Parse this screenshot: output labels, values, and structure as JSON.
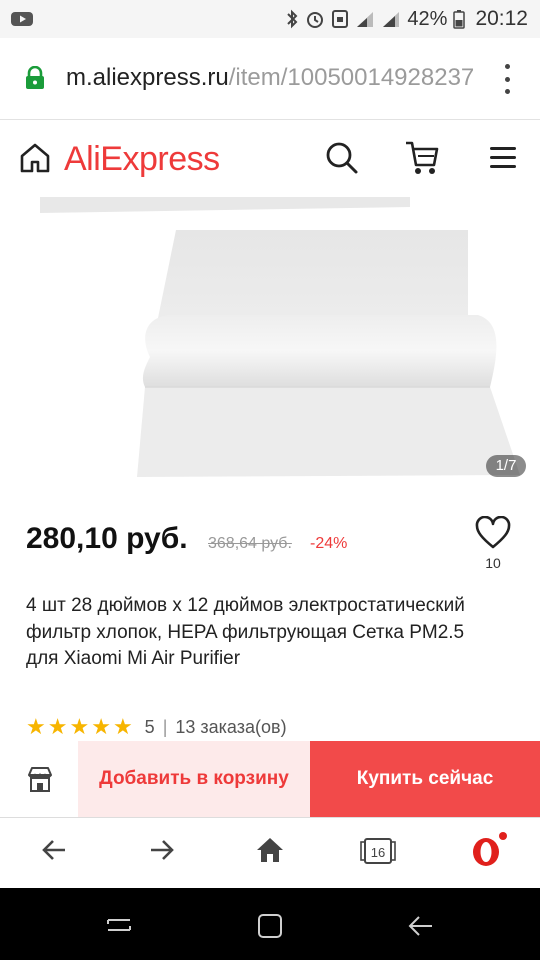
{
  "status_bar": {
    "battery": "42%",
    "time": "20:12",
    "icons": [
      "youtube-icon",
      "bluetooth-icon",
      "alarm-icon",
      "nfc-icon",
      "signal-icon",
      "signal-icon",
      "battery-icon"
    ]
  },
  "url_bar": {
    "host": "m.aliexpress.ru",
    "path": "/item/10050014928237",
    "icons": [
      "lock-icon",
      "more-vert-icon"
    ]
  },
  "header": {
    "brand": "AliExpress",
    "brand_color": "#ee3a3a",
    "icons": [
      "home-icon",
      "search-icon",
      "cart-icon",
      "menu-icon"
    ]
  },
  "gallery": {
    "counter": "1/7"
  },
  "product": {
    "price": "280,10 руб.",
    "old_price": "368,64 руб.",
    "discount": "-24%",
    "wishlist_count": "10",
    "title": "4 шт 28 дюймов x 12 дюймов электростатический фильтр хлопок, HEPA фильтрующая Сетка PM2.5 для Xiaomi Mi Air Purifier",
    "rating": "5",
    "orders": "13 заказа(ов)"
  },
  "actions": {
    "add_to_cart": "Добавить в корзину",
    "buy_now": "Купить сейчас",
    "accent": "#f24a4a"
  },
  "browser_bar": {
    "tabs_count": "16",
    "icons": [
      "back-arrow-icon",
      "forward-arrow-icon",
      "home-icon",
      "tabs-icon",
      "opera-icon"
    ]
  },
  "system_nav": {
    "icons": [
      "recents-icon",
      "home-button-icon",
      "back-icon"
    ]
  }
}
